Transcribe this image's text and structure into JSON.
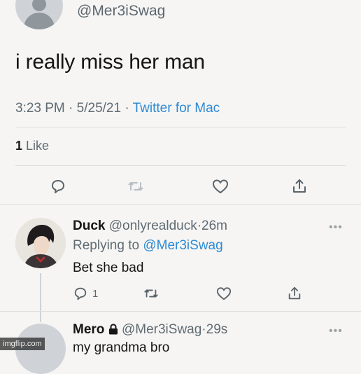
{
  "tweet": {
    "handle": "@Mer3iSwag",
    "text": "i really miss her man",
    "time": "3:23 PM",
    "date": "5/25/21",
    "source": "Twitter for Mac",
    "like_count": "1",
    "like_label": "Like"
  },
  "replies": [
    {
      "name": "Duck",
      "handle": "@onlyrealduck",
      "time": "26m",
      "replying_prefix": "Replying to",
      "replying_to": "@Mer3iSwag",
      "text": "Bet she bad",
      "reply_count": "1"
    },
    {
      "name": "Mero",
      "handle": "@Mer3iSwag",
      "time": "29s",
      "text": "my grandma bro"
    }
  ],
  "sep": "·",
  "more": "•••",
  "watermark": "imgflip.com",
  "icons": [
    "reply-icon",
    "retweet-icon",
    "like-icon",
    "share-icon",
    "lock-icon",
    "more-icon"
  ]
}
